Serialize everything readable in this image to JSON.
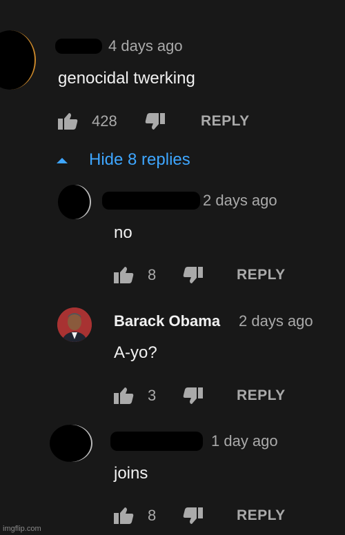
{
  "comment": {
    "time": "4 days ago",
    "text": "genocidal twerking",
    "likes": "428",
    "reply_label": "REPLY"
  },
  "hide_replies_label": "Hide 8 replies",
  "replies": [
    {
      "author": "",
      "time": "2 days ago",
      "text": "no",
      "likes": "8",
      "reply_label": "REPLY"
    },
    {
      "author": "Barack Obama",
      "time": "2 days ago",
      "text": "A-yo?",
      "likes": "3",
      "reply_label": "REPLY"
    },
    {
      "author": "",
      "time": "1 day ago",
      "text": "joins",
      "likes": "8",
      "reply_label": "REPLY"
    }
  ],
  "watermark": "imgflip.com",
  "colors": {
    "background": "#181818",
    "link_blue": "#3ea6ff",
    "secondary_text": "#aaaaaa"
  },
  "icons": [
    "thumbs-up-icon",
    "thumbs-down-icon",
    "chevron-up-icon"
  ]
}
